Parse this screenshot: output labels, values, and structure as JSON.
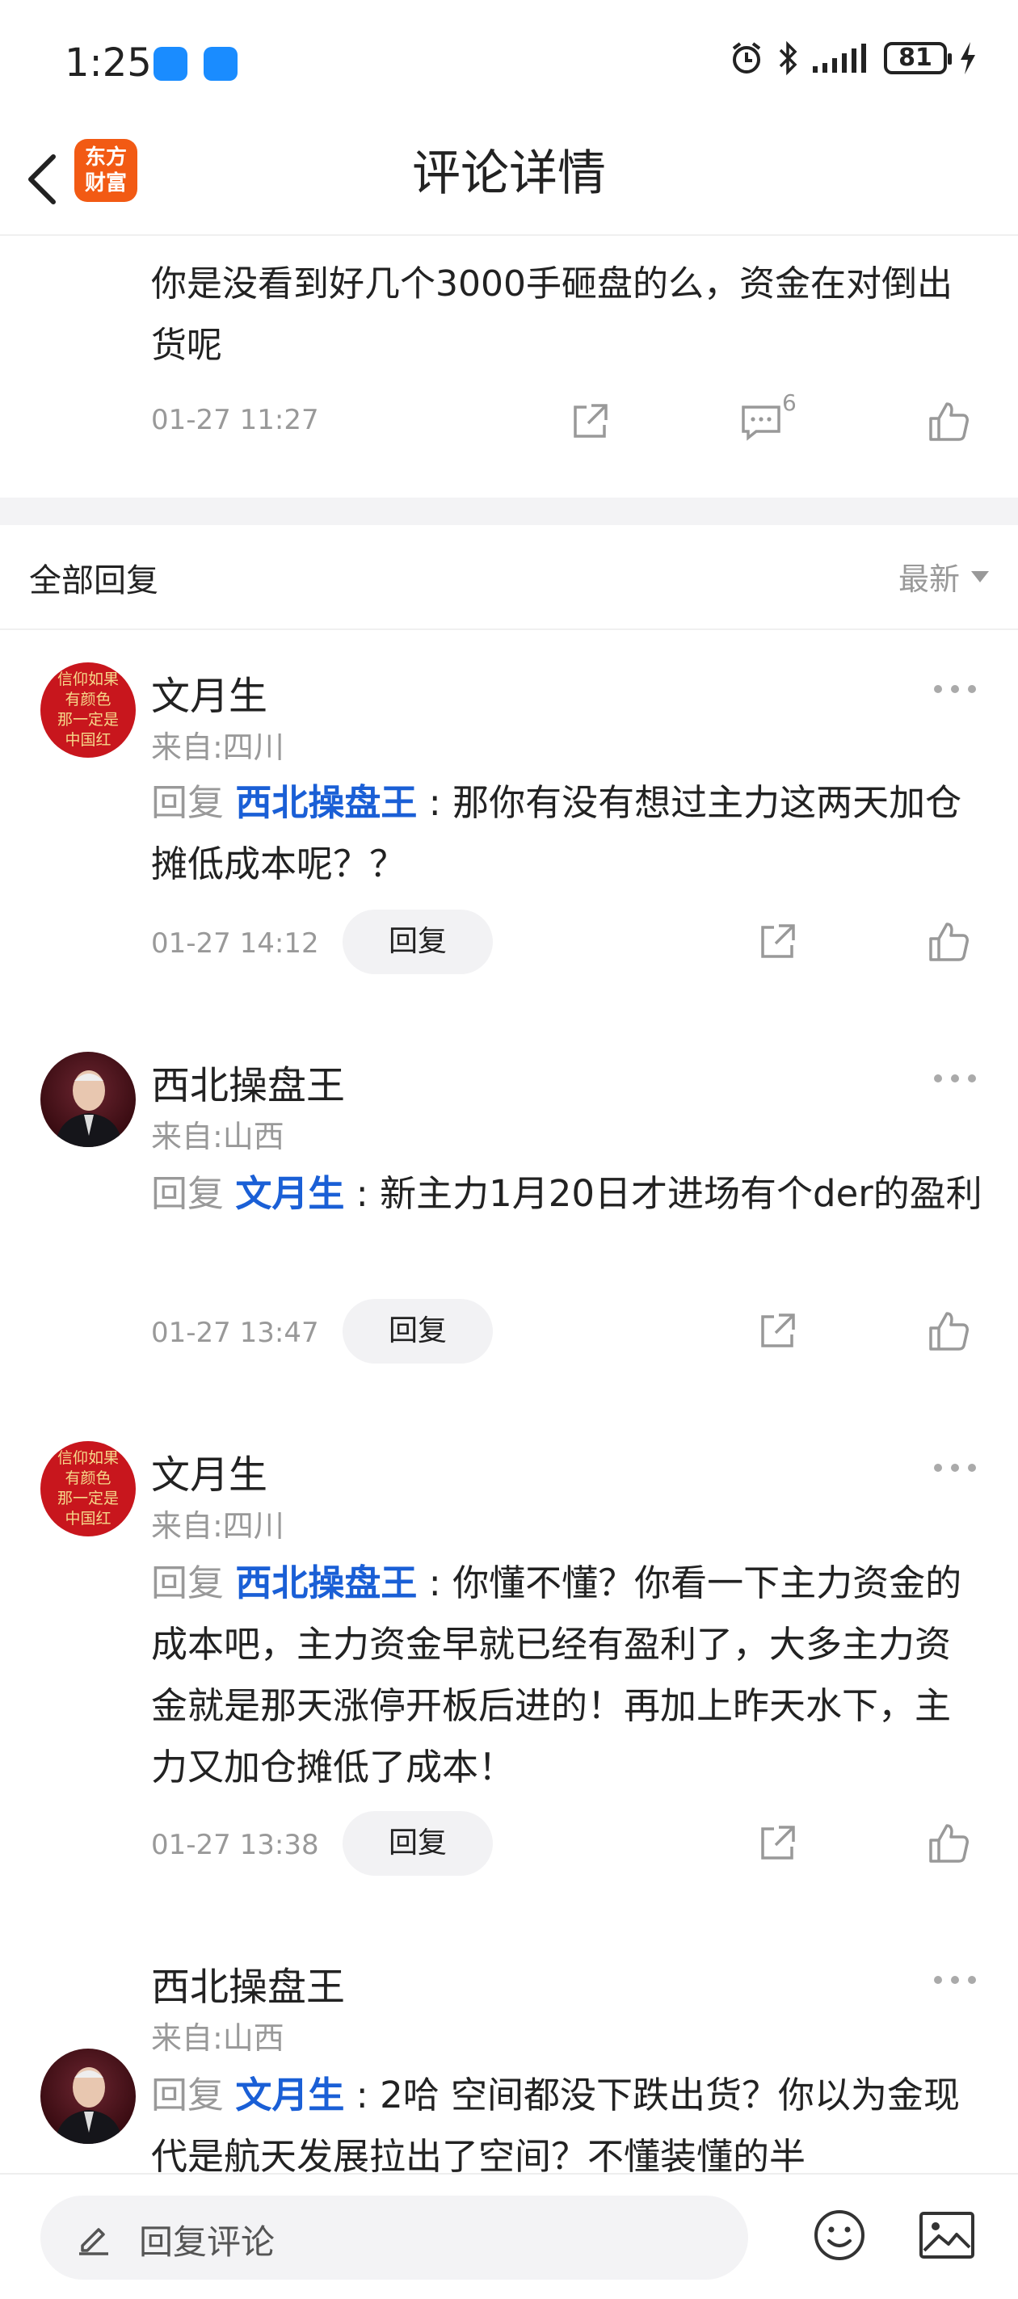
{
  "status_bar": {
    "time": "1:25",
    "battery": "81"
  },
  "nav": {
    "logo_line1": "东方",
    "logo_line2": "财富",
    "title": "评论详情"
  },
  "main_comment": {
    "text": "你是没看到好几个3000手砸盘的么，资金在对倒出货呢",
    "time": "01-27 11:27",
    "comment_count": "6"
  },
  "section": {
    "title": "全部回复",
    "sort_label": "最新"
  },
  "avatar_text": {
    "line1": "信仰如果",
    "line2": "有颜色",
    "line3": "那一定是",
    "line4": "中国红"
  },
  "replies": [
    {
      "author": "文月生",
      "origin": "来自:四川",
      "prefix": "回复",
      "mention": "西北操盘王",
      "separator": " : ",
      "text": "那你有没有想过主力这两天加仓摊低成本呢？？",
      "time": "01-27 14:12",
      "reply_label": "回复"
    },
    {
      "author": "西北操盘王",
      "origin": "来自:山西",
      "prefix": "回复",
      "mention": "文月生",
      "separator": " : ",
      "text": "新主力1月20日才进场有个der的盈利",
      "time": "01-27 13:47",
      "reply_label": "回复"
    },
    {
      "author": "文月生",
      "origin": "来自:四川",
      "prefix": "回复",
      "mention": "西北操盘王",
      "separator": " : ",
      "text": "你懂不懂？你看一下主力资金的成本吧，主力资金早就已经有盈利了，大多主力资金就是那天涨停开板后进的！再加上昨天水下，主力又加仓摊低了成本！",
      "time": "01-27 13:38",
      "reply_label": "回复"
    },
    {
      "author": "西北操盘王",
      "origin": "来自:山西",
      "prefix": "回复",
      "mention": "文月生",
      "separator": " : ",
      "text": "2哈 空间都没下跌出货？你以为金现代是航天发展拉出了空间？不懂装懂的半"
    }
  ],
  "bottom_bar": {
    "placeholder": "回复评论"
  },
  "colors": {
    "accent_blue": "#1a5fd6",
    "logo_orange": "#f25a14",
    "muted": "#999999"
  }
}
